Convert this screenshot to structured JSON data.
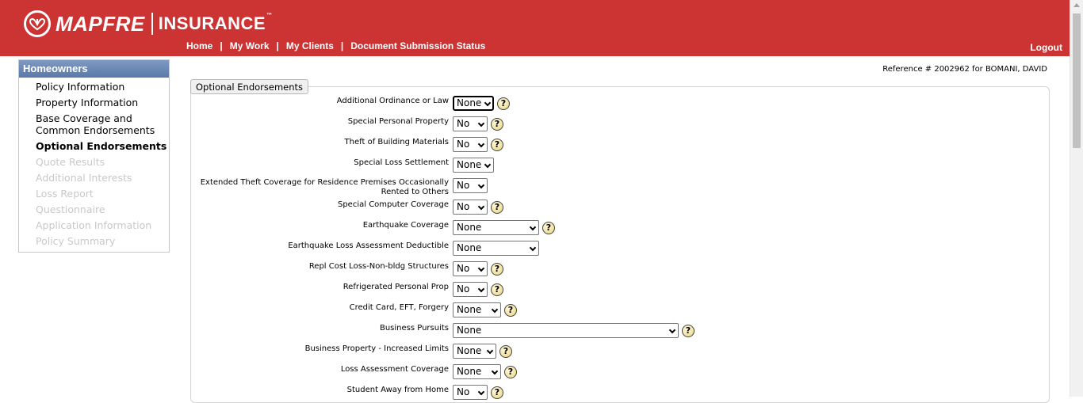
{
  "header": {
    "brand": "MAPFRE",
    "brand_sub": "INSURANCE",
    "trademark": "™",
    "nav": [
      {
        "label": "Home"
      },
      {
        "label": "My Work"
      },
      {
        "label": "My Clients"
      },
      {
        "label": "Document Submission Status"
      }
    ],
    "nav_separator": "|",
    "logout": "Logout"
  },
  "sidebar": {
    "title": "Homeowners",
    "items": [
      {
        "label": "Policy Information",
        "state": "enabled"
      },
      {
        "label": "Property Information",
        "state": "enabled"
      },
      {
        "label": "Base Coverage and Common Endorsements",
        "state": "enabled"
      },
      {
        "label": "Optional Endorsements",
        "state": "active"
      },
      {
        "label": "Quote Results",
        "state": "disabled"
      },
      {
        "label": "Additional Interests",
        "state": "disabled"
      },
      {
        "label": "Loss Report",
        "state": "disabled"
      },
      {
        "label": "Questionnaire",
        "state": "disabled"
      },
      {
        "label": "Application Information",
        "state": "disabled"
      },
      {
        "label": "Policy Summary",
        "state": "disabled"
      }
    ]
  },
  "reference": "Reference # 2002962 for BOMANI, DAVID",
  "section_title": "Optional Endorsements",
  "help_glyph": "?",
  "fields": [
    {
      "label": "Additional Ordinance or Law",
      "value": "None",
      "help": true,
      "focused": true
    },
    {
      "label": "Special Personal Property",
      "value": "No",
      "help": true
    },
    {
      "label": "Theft of Building Materials",
      "value": "No",
      "help": true
    },
    {
      "label": "Special Loss Settlement",
      "value": "None",
      "help": false
    },
    {
      "label": "Extended Theft Coverage for Residence Premises Occasionally Rented to Others",
      "value": "No",
      "help": false
    },
    {
      "label": "Special Computer Coverage",
      "value": "No",
      "help": true
    },
    {
      "label": "Earthquake Coverage",
      "value": "None",
      "help": true
    },
    {
      "label": "Earthquake Loss Assessment Deductible",
      "value": "None",
      "help": false
    },
    {
      "label": "Repl Cost Loss-Non-bldg Structures",
      "value": "No",
      "help": true
    },
    {
      "label": "Refrigerated Personal Prop",
      "value": "No",
      "help": true
    },
    {
      "label": "Credit Card, EFT, Forgery",
      "value": "None",
      "help": true
    },
    {
      "label": "Business Pursuits",
      "value": "None",
      "help": true
    },
    {
      "label": "Business Property - Increased Limits",
      "value": "None",
      "help": true
    },
    {
      "label": "Loss Assessment Coverage",
      "value": "None",
      "help": true
    },
    {
      "label": "Student Away from Home",
      "value": "No",
      "help": true
    }
  ],
  "colors": {
    "header": "#cc3333",
    "sidebar_head": "#5a79a8",
    "disabled_text": "#c8c8c8"
  }
}
